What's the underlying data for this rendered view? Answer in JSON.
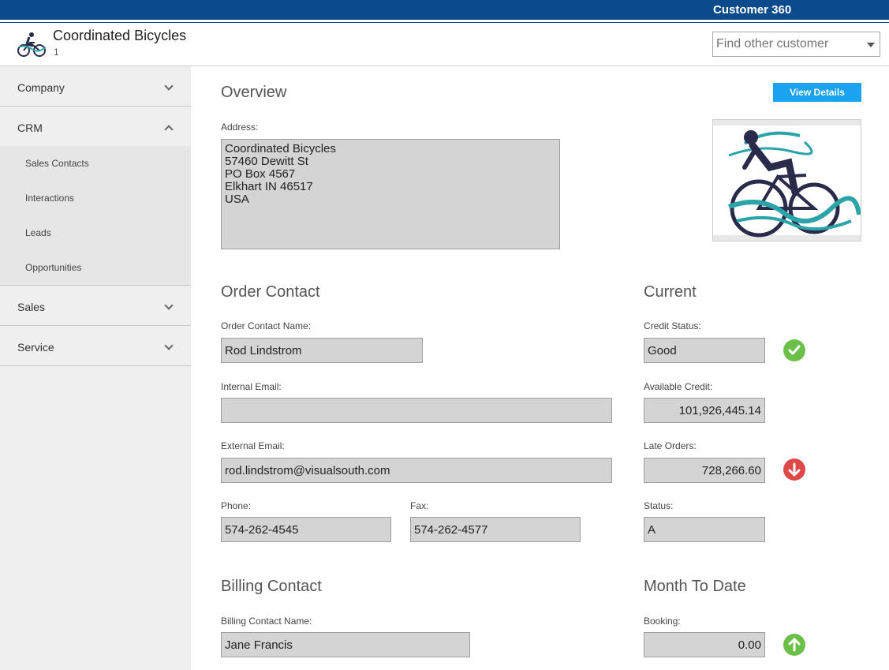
{
  "app": {
    "title": "Customer 360"
  },
  "customer": {
    "name": "Coordinated Bicycles",
    "number": "1"
  },
  "search": {
    "placeholder": "Find other customer"
  },
  "sidebar": {
    "groups": [
      {
        "label": "Company"
      },
      {
        "label": "CRM",
        "items": [
          {
            "label": "Sales Contacts"
          },
          {
            "label": "Interactions"
          },
          {
            "label": "Leads"
          },
          {
            "label": "Opportunities"
          }
        ]
      },
      {
        "label": "Sales"
      },
      {
        "label": "Service"
      }
    ]
  },
  "overview": {
    "title": "Overview",
    "view_details": "View Details",
    "address_label": "Address:",
    "address_lines": [
      "Coordinated Bicycles",
      "57460 Dewitt St",
      "PO Box 4567",
      "Elkhart IN 46517",
      "USA"
    ]
  },
  "order_contact": {
    "title": "Order Contact",
    "name_label": "Order Contact Name:",
    "name": "Rod Lindstrom",
    "internal_email_label": "Internal Email:",
    "internal_email": "",
    "external_email_label": "External Email:",
    "external_email": "rod.lindstrom@visualsouth.com",
    "phone_label": "Phone:",
    "phone": "574-262-4545",
    "fax_label": "Fax:",
    "fax": "574-262-4577"
  },
  "current": {
    "title": "Current",
    "credit_status_label": "Credit Status:",
    "credit_status": "Good",
    "available_credit_label": "Available Credit:",
    "available_credit": "101,926,445.14",
    "late_orders_label": "Late Orders:",
    "late_orders": "728,266.60",
    "status_label": "Status:",
    "status": "A"
  },
  "billing_contact": {
    "title": "Billing Contact",
    "name_label": "Billing Contact Name:",
    "name": "Jane Francis"
  },
  "month_to_date": {
    "title": "Month To Date",
    "booking_label": "Booking:",
    "booking": "0.00"
  },
  "icons": {
    "credit_status": "check-circle-icon",
    "late_orders": "arrow-down-circle-icon",
    "booking": "arrow-up-circle-icon"
  },
  "colors": {
    "brand": "#0b4a8b",
    "button": "#1aa3f0",
    "ok": "#6cc04a",
    "alert": "#e04848"
  }
}
